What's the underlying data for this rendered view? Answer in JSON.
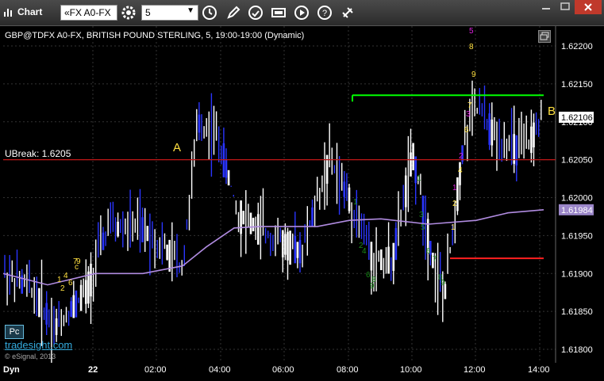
{
  "window": {
    "title": "Chart"
  },
  "toolbar": {
    "symbol_value": "«FX A0-FX",
    "interval_value": "5",
    "buttons": [
      "settings-icon",
      "clock-icon",
      "pencil-icon",
      "refresh-icon",
      "news-icon",
      "play-icon",
      "help-icon",
      "link-icon"
    ]
  },
  "legend": {
    "text": "GBP@TDFX A0-FX, BRITISH POUND STERLING, 5, 19:00-19:00 (Dynamic)"
  },
  "ubreak": {
    "label": "UBreak: 1.6205",
    "value": 1.6205
  },
  "price_axis": {
    "ticks": [
      "1.62200",
      "1.62150",
      "1.62100",
      "1.62050",
      "1.62000",
      "1.61950",
      "1.61900",
      "1.61850",
      "1.61800"
    ],
    "last_price": "1.62106",
    "ma_price": "1.61984"
  },
  "time_axis": {
    "ticks": [
      "22",
      "02:00",
      "04:00",
      "06:00",
      "08:00",
      "10:00",
      "12:00",
      "14:00"
    ]
  },
  "annotations": {
    "a": "A",
    "b": "B"
  },
  "levels": {
    "green": 1.62135,
    "red_upper": 1.6205,
    "red_lower": 1.6192
  },
  "footer": {
    "dyn": "Dyn",
    "pc": "Pc",
    "brand": "tradesight.com",
    "copyright": "© eSignal, 2013"
  },
  "colors": {
    "green_line": "#00ff00",
    "red_line": "#ff2020",
    "ma_line": "#b08be0",
    "bar_white": "#ffffff",
    "bar_blue": "#2a35ff",
    "yellow": "#ffe040",
    "magenta": "#e020e0",
    "dgreen": "#1a8a1a"
  },
  "chart_data": {
    "type": "candlestick-bars",
    "symbol": "GBP@TDFX A0-FX",
    "ylim": [
      1.6178,
      1.6224
    ],
    "ma_last": 1.61984,
    "close_last": 1.62106
  }
}
